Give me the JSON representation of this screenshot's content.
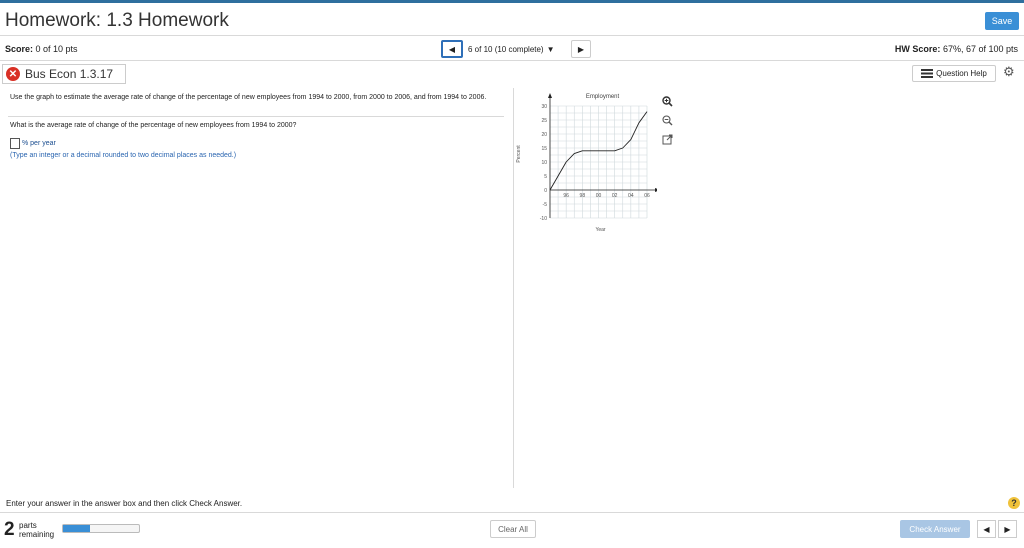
{
  "header": {
    "title": "Homework: 1.3 Homework",
    "save_label": "Save",
    "score_label": "Score:",
    "score_value": "0 of 10 pts",
    "nav_prev": "◀",
    "nav_position": "6 of 10 (10 complete)",
    "nav_dropdown": "▼",
    "nav_next": "▶",
    "hw_score_label": "HW Score:",
    "hw_score_value": "67%, 67 of 100 pts"
  },
  "question": {
    "status_icon": "x-icon",
    "name": "Bus Econ 1.3.17",
    "help_label": "Question Help",
    "prompt_line": "Use the graph to estimate the average rate of change of the percentage of new employees from 1994 to 2000, from 2000 to 2006, and from 1994 to 2006.",
    "sub_question": "What is the average rate of change of the percentage of new employees from 1994 to 2000?",
    "unit_label": "% per year",
    "hint": "(Type an integer or a decimal rounded to two decimal places as needed.)"
  },
  "chart_data": {
    "type": "line",
    "title": "Employment",
    "xlabel": "Year",
    "ylabel": "Percent",
    "x_tick_labels": [
      "96",
      "98",
      "00",
      "02",
      "04",
      "06"
    ],
    "y_tick_labels": [
      "30",
      "25",
      "20",
      "15",
      "10",
      "5",
      "0",
      "-5",
      "-10"
    ],
    "ylim": [
      -10,
      30
    ],
    "xlim": [
      1994,
      2006
    ],
    "grid": true,
    "series": [
      {
        "x": [
          1994,
          1995,
          1996,
          1997,
          1998,
          2000,
          2002,
          2003,
          2004,
          2005,
          2006
        ],
        "y": [
          0,
          5,
          10,
          13,
          14,
          14,
          14,
          15,
          18,
          24,
          28
        ]
      }
    ]
  },
  "graph_tools": [
    "zoom-in-icon",
    "zoom-out-icon",
    "expand-icon"
  ],
  "footer": {
    "instruction": "Enter your answer in the answer box and then click Check Answer.",
    "help_symbol": "?",
    "parts_count": "2",
    "parts_word1": "parts",
    "parts_word2": "remaining",
    "progress_fraction": 0.35,
    "clear_label": "Clear All",
    "check_label": "Check Answer",
    "prev_symbol": "◀",
    "next_symbol": "▶"
  },
  "colors": {
    "accent": "#3a8fd6",
    "error": "#d93025",
    "help": "#f0c23b"
  }
}
